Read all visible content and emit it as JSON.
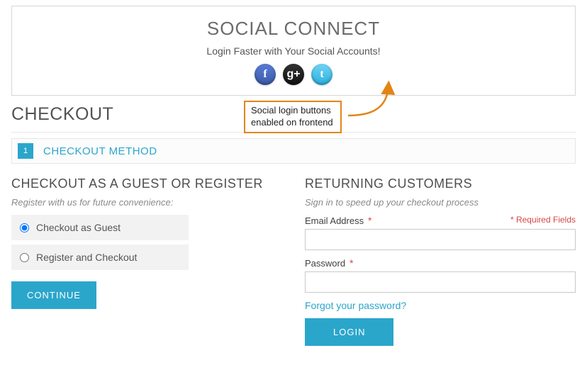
{
  "social": {
    "title": "SOCIAL CONNECT",
    "subtitle": "Login Faster with Your Social Accounts!",
    "icons": {
      "facebook": "f",
      "google": "g+",
      "twitter": "t"
    }
  },
  "page_title": "CHECKOUT",
  "step": {
    "number": "1",
    "label": "CHECKOUT METHOD"
  },
  "guest": {
    "heading": "CHECKOUT AS A GUEST OR REGISTER",
    "note": "Register with us for future convenience:",
    "option_guest": "Checkout as Guest",
    "option_register": "Register and Checkout",
    "continue_btn": "CONTINUE"
  },
  "login": {
    "heading": "RETURNING CUSTOMERS",
    "note": "Sign in to speed up your checkout process",
    "email_label": "Email Address",
    "password_label": "Password",
    "required_note": "* Required Fields",
    "forgot": "Forgot your password?",
    "login_btn": "LOGIN"
  },
  "annotation": {
    "line1": "Social login buttons",
    "line2": "enabled on frontend"
  }
}
